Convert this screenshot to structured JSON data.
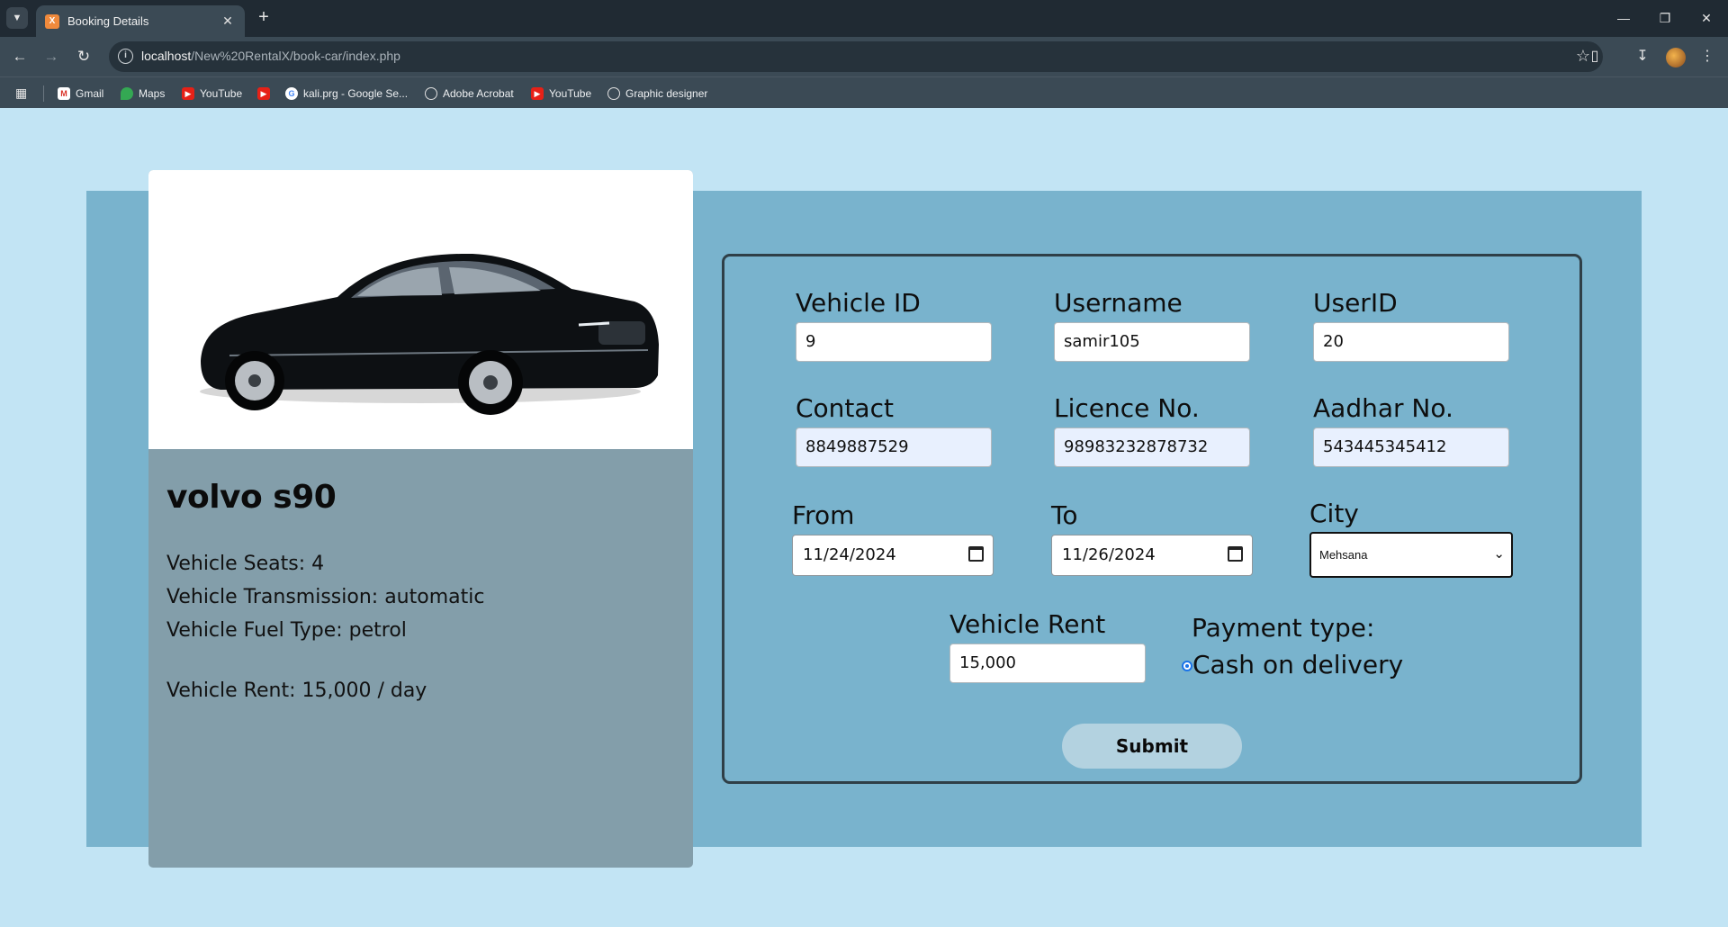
{
  "browser": {
    "tab_title": "Booking Details",
    "url_host": "localhost",
    "url_path": "/New%20RentalX/book-car/index.php",
    "bookmarks": [
      {
        "label": "Gmail",
        "icon": "gmail-icon"
      },
      {
        "label": "Maps",
        "icon": "maps-icon"
      },
      {
        "label": "YouTube",
        "icon": "youtube-icon"
      },
      {
        "label": "",
        "icon": "youtube-icon"
      },
      {
        "label": "kali.prg - Google Se...",
        "icon": "google-icon"
      },
      {
        "label": "Adobe Acrobat",
        "icon": "globe-icon"
      },
      {
        "label": "YouTube",
        "icon": "youtube-icon"
      },
      {
        "label": "Graphic designer",
        "icon": "globe-icon"
      }
    ]
  },
  "car": {
    "name": "volvo s90",
    "seats": "Vehicle Seats: 4",
    "transmission": "Vehicle Transmission: automatic",
    "fuel": "Vehicle Fuel Type: petrol",
    "rent": "Vehicle Rent: 15,000 / day"
  },
  "form": {
    "vehicle_id": {
      "label": "Vehicle ID",
      "value": "9"
    },
    "username": {
      "label": "Username",
      "value": "samir105"
    },
    "user_id": {
      "label": "UserID",
      "value": "20"
    },
    "contact": {
      "label": "Contact",
      "value": "8849887529"
    },
    "licence": {
      "label": "Licence No.",
      "value": "98983232878732"
    },
    "aadhar": {
      "label": "Aadhar No.",
      "value": "543445345412"
    },
    "from": {
      "label": "From",
      "value": "11/24/2024"
    },
    "to": {
      "label": "To",
      "value": "11/26/2024"
    },
    "city": {
      "label": "City",
      "value": "Mehsana"
    },
    "rent": {
      "label": "Vehicle Rent",
      "value": "15,000"
    },
    "payment": {
      "label": "Payment type:",
      "option": "Cash on delivery"
    },
    "submit_label": "Submit"
  },
  "colors": {
    "page_bg": "#c2e4f4",
    "panel_bg": "#79b3cd",
    "card_bg": "#839eaa",
    "submit_bg": "#b3d2e0"
  }
}
